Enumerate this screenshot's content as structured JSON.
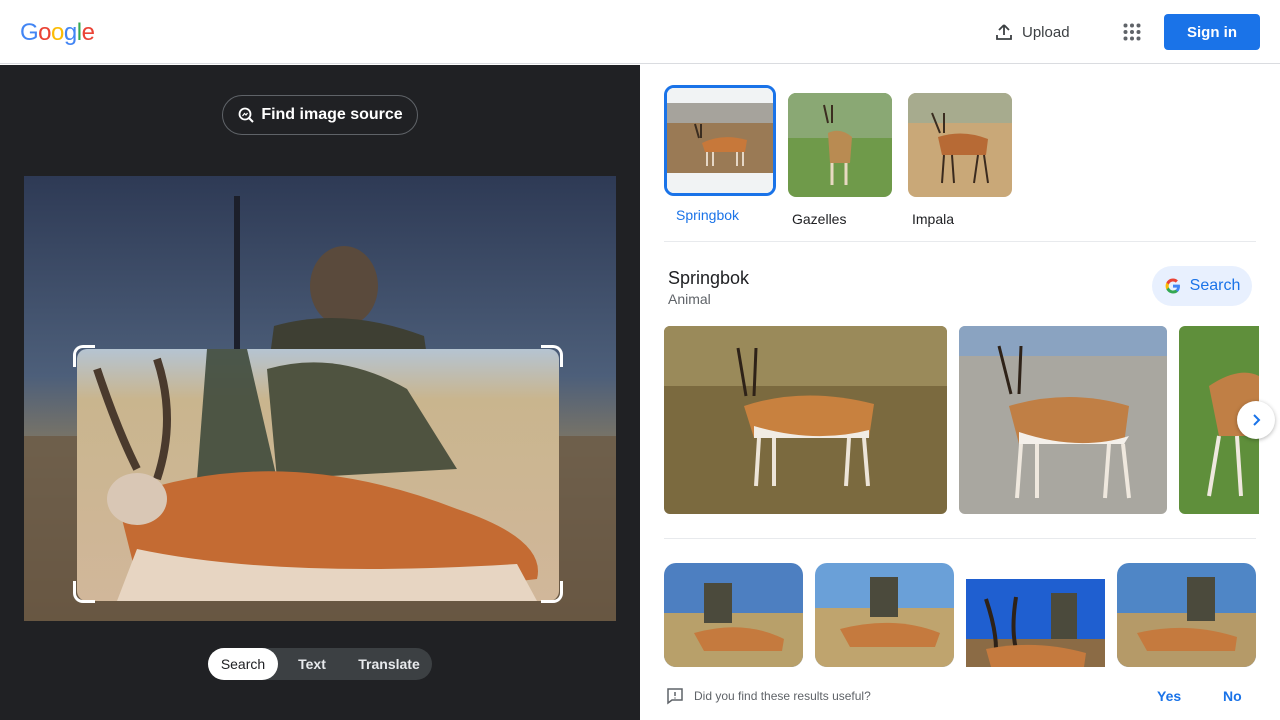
{
  "header": {
    "logo_letters": [
      "G",
      "o",
      "o",
      "g",
      "l",
      "e"
    ],
    "logo_colors": [
      "#4285f4",
      "#ea4335",
      "#fbbc05",
      "#4285f4",
      "#34a853",
      "#ea4335"
    ],
    "upload_label": "Upload",
    "signin_label": "Sign in"
  },
  "left": {
    "find_source_label": "Find image source",
    "modes": [
      "Search",
      "Text",
      "Translate"
    ],
    "active_mode": "Search"
  },
  "chips": [
    {
      "label": "Springbok",
      "selected": true
    },
    {
      "label": "Gazelles",
      "selected": false
    },
    {
      "label": "Impala",
      "selected": false
    }
  ],
  "knowledge_panel": {
    "title": "Springbok",
    "subtitle": "Animal",
    "search_label": "Search"
  },
  "feedback": {
    "question": "Did you find these results useful?",
    "yes": "Yes",
    "no": "No"
  },
  "colors": {
    "accent": "#1a73e8",
    "dark_bg": "#202124"
  }
}
